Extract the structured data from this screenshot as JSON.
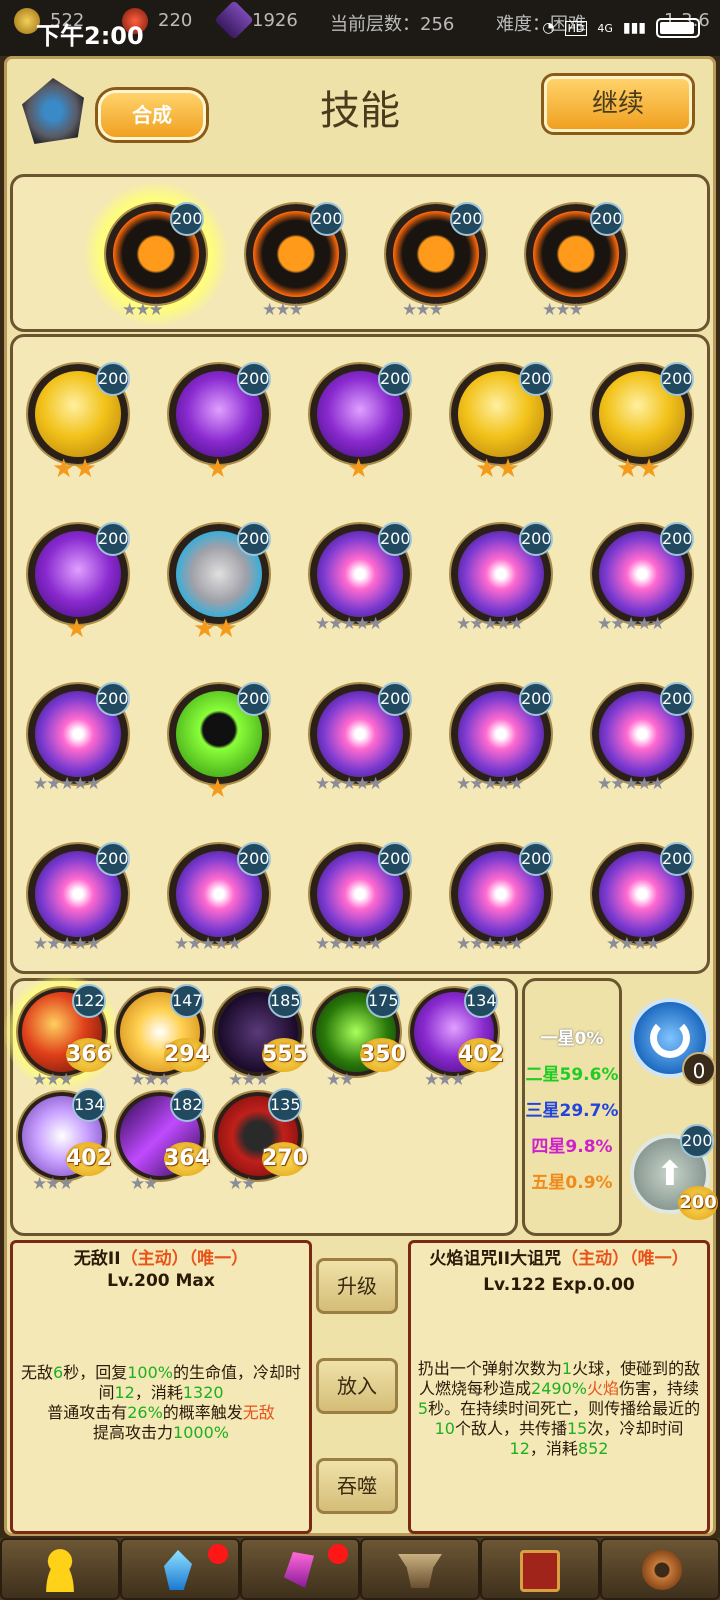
{
  "status": {
    "time": "下午2:00",
    "net": "4G",
    "hd": "HD",
    "res_coin": "522",
    "res_fire": "220",
    "res_crystal": "1926",
    "floor_label": "当前层数：256",
    "difficulty": "难度：困难",
    "version": "1.3.6"
  },
  "header": {
    "title": "技能",
    "synth": "合成",
    "continue": "继续"
  },
  "equipped": [
    {
      "level": "200",
      "stars": 3,
      "star_type": "gray"
    },
    {
      "level": "200",
      "stars": 3,
      "star_type": "gray"
    },
    {
      "level": "200",
      "stars": 3,
      "star_type": "gray"
    },
    {
      "level": "200",
      "stars": 3,
      "star_type": "gray"
    }
  ],
  "grid": [
    {
      "level": "200",
      "icon": "gold-shield-icon",
      "stars": 2,
      "star_type": "orange"
    },
    {
      "level": "200",
      "icon": "purple-lightning-icon",
      "stars": 1,
      "star_type": "orange"
    },
    {
      "level": "200",
      "icon": "purple-lightning-icon",
      "stars": 1,
      "star_type": "orange"
    },
    {
      "level": "200",
      "icon": "gold-shield-icon",
      "stars": 2,
      "star_type": "orange"
    },
    {
      "level": "200",
      "icon": "gold-shield-icon",
      "stars": 2,
      "star_type": "orange"
    },
    {
      "level": "200",
      "icon": "purple-lightning-icon",
      "stars": 1,
      "star_type": "orange"
    },
    {
      "level": "200",
      "icon": "stone-armor-icon",
      "stars": 2,
      "star_type": "orange"
    },
    {
      "level": "200",
      "icon": "purple-orb-icon",
      "stars": 5,
      "star_type": "gray"
    },
    {
      "level": "200",
      "icon": "purple-orb-icon",
      "stars": 5,
      "star_type": "gray"
    },
    {
      "level": "200",
      "icon": "purple-orb-icon",
      "stars": 5,
      "star_type": "gray"
    },
    {
      "level": "200",
      "icon": "purple-orb-icon",
      "stars": 5,
      "star_type": "gray"
    },
    {
      "level": "200",
      "icon": "green-skull-icon",
      "stars": 1,
      "star_type": "orange"
    },
    {
      "level": "200",
      "icon": "purple-orb-icon",
      "stars": 5,
      "star_type": "gray"
    },
    {
      "level": "200",
      "icon": "purple-orb-icon",
      "stars": 5,
      "star_type": "gray"
    },
    {
      "level": "200",
      "icon": "purple-orb-icon",
      "stars": 5,
      "star_type": "gray"
    },
    {
      "level": "200",
      "icon": "purple-orb-icon",
      "stars": 5,
      "star_type": "gray"
    },
    {
      "level": "200",
      "icon": "purple-orb-icon",
      "stars": 5,
      "star_type": "gray"
    },
    {
      "level": "200",
      "icon": "purple-orb-icon",
      "stars": 5,
      "star_type": "gray"
    },
    {
      "level": "200",
      "icon": "purple-orb-icon",
      "stars": 5,
      "star_type": "gray"
    },
    {
      "level": "200",
      "icon": "purple-orb-icon",
      "stars": 4,
      "star_type": "gray"
    }
  ],
  "inventory": [
    {
      "level": "122",
      "exp": "366",
      "icon": "fire-orb-icon",
      "stars": 3
    },
    {
      "level": "147",
      "exp": "294",
      "icon": "sun-burst-icon",
      "stars": 3
    },
    {
      "level": "185",
      "exp": "555",
      "icon": "dark-slash-icon",
      "stars": 3
    },
    {
      "level": "175",
      "exp": "350",
      "icon": "green-dash-icon",
      "stars": 2
    },
    {
      "level": "134",
      "exp": "402",
      "icon": "purple-lightning-icon",
      "stars": 3
    },
    {
      "level": "134",
      "exp": "402",
      "icon": "ice-burst-icon",
      "stars": 3
    },
    {
      "level": "182",
      "exp": "364",
      "icon": "purple-slash-icon",
      "stars": 2
    },
    {
      "level": "135",
      "exp": "270",
      "icon": "red-armor-icon",
      "stars": 2
    }
  ],
  "rates": [
    {
      "label": "一星0%",
      "color": "#ffffff"
    },
    {
      "label": "二星59.6%",
      "color": "#22cc22"
    },
    {
      "label": "三星29.7%",
      "color": "#2244dd"
    },
    {
      "label": "四星9.8%",
      "color": "#cc22cc"
    },
    {
      "label": "五星0.9%",
      "color": "#f08a1a"
    }
  ],
  "refresh": {
    "count": "0"
  },
  "upgrade_arrow": {
    "level": "200",
    "cost": "200"
  },
  "left_info": {
    "name": "无敌II",
    "tag1": "（主动）",
    "tag2": "（唯一）",
    "level": "Lv.200 Max",
    "d1": "无敌",
    "d2": "6",
    "d3": "秒，回复",
    "d4": "100%",
    "d5": "的生命值，冷却时间",
    "d6": "12",
    "d7": "，消耗",
    "d8": "1320",
    "d9": "普通攻击有",
    "d10": "26%",
    "d11": "的概率触发",
    "d12": "无敌",
    "d13": "提高攻击力",
    "d14": "1000%"
  },
  "actions": {
    "upgrade": "升级",
    "put_in": "放入",
    "devour": "吞噬"
  },
  "right_info": {
    "name": "火焰诅咒II大诅咒",
    "tag1": "（主动）",
    "tag2": "（唯一）",
    "level": "Lv.122 Exp.0.00",
    "d1": "扔出一个弹射次数为",
    "d2": "1",
    "d3": "火球，使碰到的敌人燃烧每秒造成",
    "d4": "2490%",
    "d5": "火焰",
    "d6": "伤害，持续",
    "d7": "5",
    "d8": "秒。在持续时间死亡，则传播给最近的",
    "d9": "10",
    "d10": "个敌人，共传播",
    "d11": "15",
    "d12": "次，冷却时间",
    "d13": "12",
    "d14": "，消耗",
    "d15": "852"
  },
  "colors": {
    "panel_bg": "#f3e8b6",
    "frame": "#6b5530",
    "accent_gold": "#f0a020",
    "level_badge": "#214a60"
  }
}
